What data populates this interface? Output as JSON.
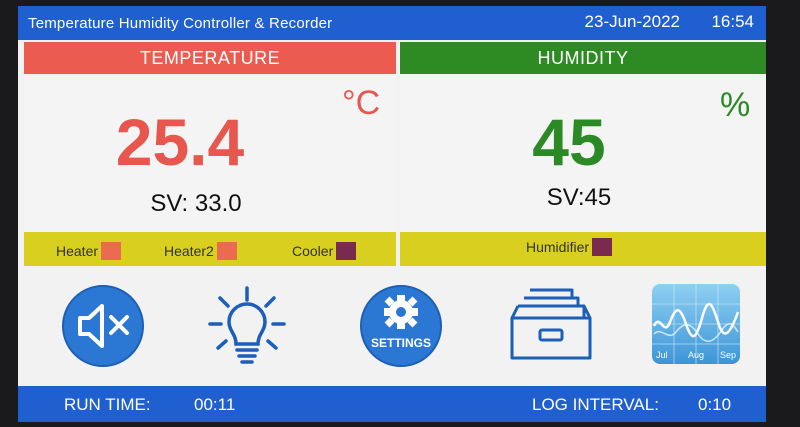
{
  "title_bar": {
    "title": "Temperature Humidity Controller & Recorder",
    "date": "23-Jun-2022",
    "time": "16:54"
  },
  "temperature": {
    "header": "TEMPERATURE",
    "value": "25.4",
    "unit": "°C",
    "setpoint": "SV:  33.0",
    "indicators": [
      {
        "label": "Heater",
        "color": "#ec6a4f"
      },
      {
        "label": "Heater2",
        "color": "#ec6a4f"
      },
      {
        "label": "Cooler",
        "color": "#7b2a4f"
      }
    ]
  },
  "humidity": {
    "header": "HUMIDITY",
    "value": "45",
    "unit": "%",
    "setpoint": "SV:45",
    "indicators": [
      {
        "label": "Humidifier",
        "color": "#7b2a4f"
      }
    ]
  },
  "toolbar": {
    "settings_label": "SETTINGS",
    "chart_axis_labels": [
      "Jul",
      "Aug",
      "Sep"
    ],
    "icons": [
      "mute-icon",
      "light-bulb-icon",
      "settings-icon",
      "records-drawer-icon",
      "chart-icon"
    ]
  },
  "footer": {
    "run_time_label": "RUN TIME:",
    "run_time_value": "00:11",
    "log_interval_label": "LOG INTERVAL:",
    "log_interval_value": "0:10"
  },
  "colors": {
    "bar_blue": "#1f5fd0",
    "temp_red": "#e8574d",
    "hum_green": "#2c8a26",
    "status_yellow": "#d8cf1e"
  }
}
